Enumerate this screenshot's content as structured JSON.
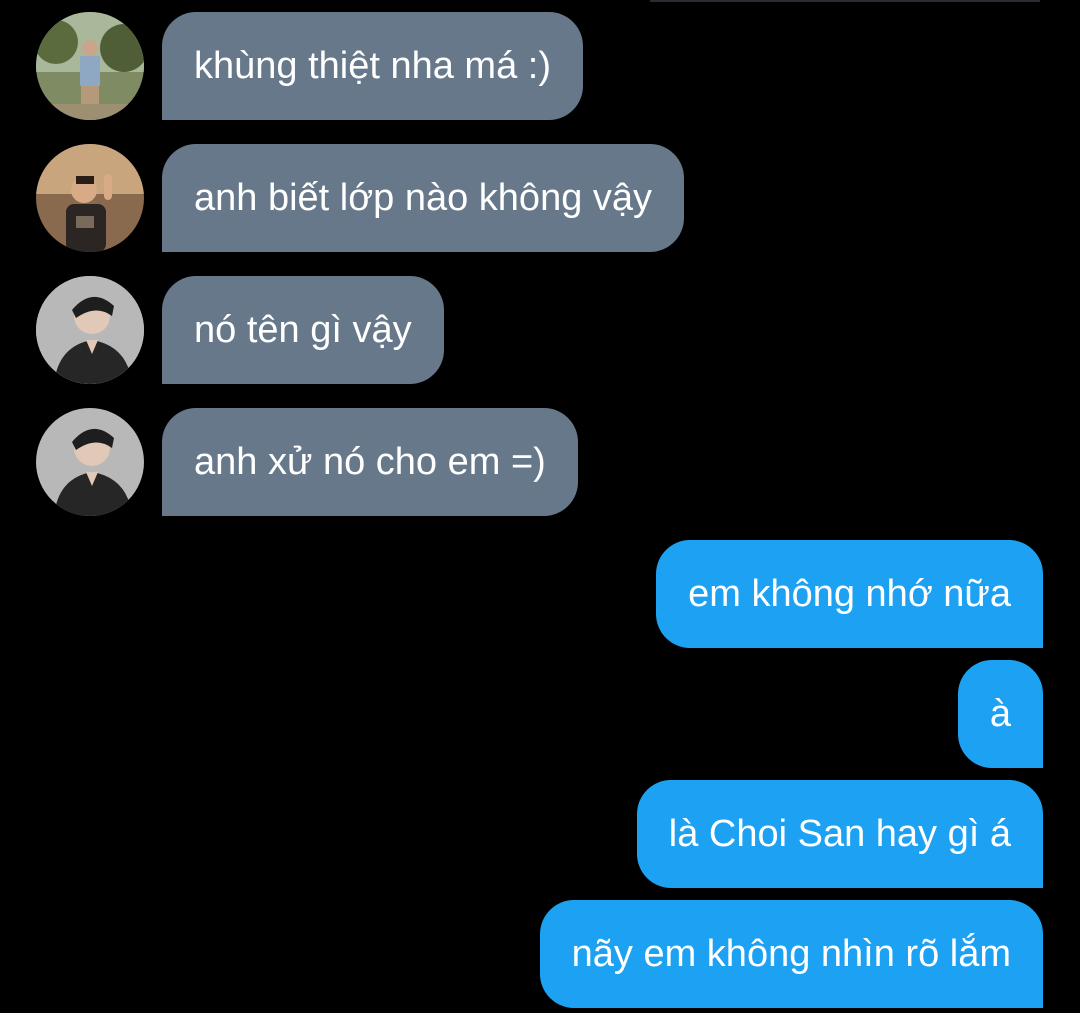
{
  "colors": {
    "background": "#000000",
    "incoming_bubble": "#66788a",
    "outgoing_bubble": "#1da1f2",
    "text": "#ffffff"
  },
  "messages": [
    {
      "direction": "incoming",
      "text": "khùng thiệt nha má :)",
      "avatar": "user-photo-outdoor"
    },
    {
      "direction": "incoming",
      "text": "anh biết lớp nào không vậy",
      "avatar": "user-photo-peace-sign"
    },
    {
      "direction": "incoming",
      "text": "nó tên gì vậy",
      "avatar": "user-photo-portrait"
    },
    {
      "direction": "incoming",
      "text": "anh xử nó cho em =)",
      "avatar": "user-photo-portrait"
    },
    {
      "direction": "outgoing",
      "text": "em không nhớ nữa"
    },
    {
      "direction": "outgoing",
      "text": "à"
    },
    {
      "direction": "outgoing",
      "text": "là Choi San hay gì á"
    },
    {
      "direction": "outgoing",
      "text": "nãy em không nhìn rõ lắm"
    }
  ]
}
